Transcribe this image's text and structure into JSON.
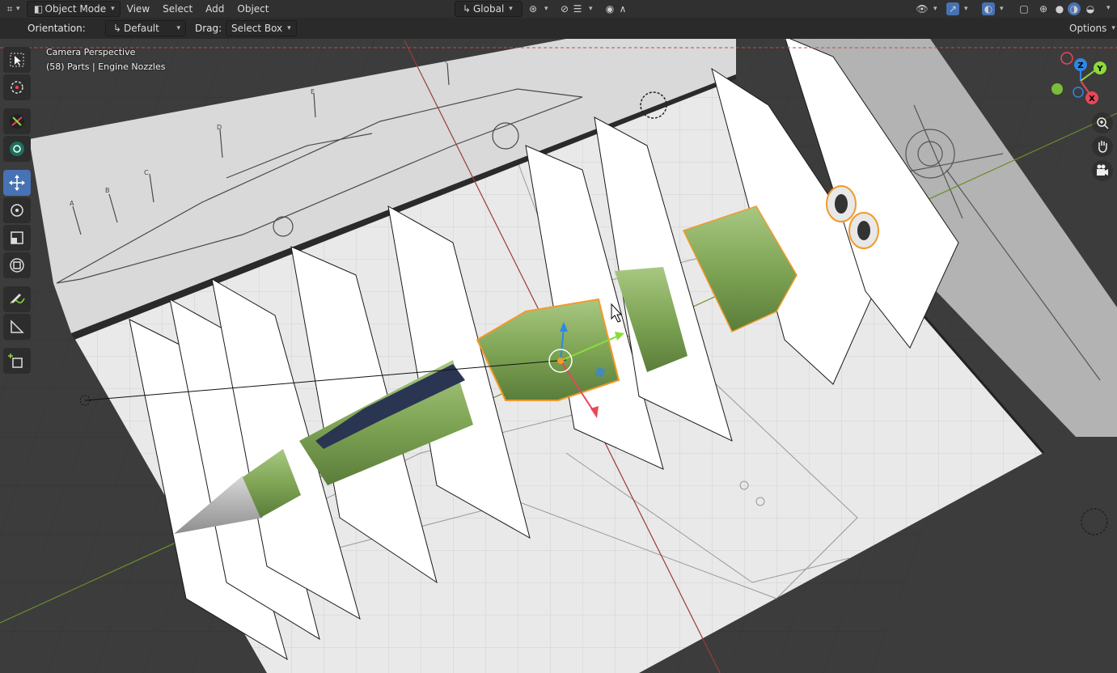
{
  "header": {
    "mode": "Object Mode",
    "menus": [
      "View",
      "Select",
      "Add",
      "Object"
    ],
    "transform_orientation": "Global"
  },
  "tool_settings": {
    "orientation_label": "Orientation:",
    "orientation_value": "Default",
    "drag_label": "Drag:",
    "drag_value": "Select Box",
    "options_label": "Options"
  },
  "viewport": {
    "view_name": "Camera Perspective",
    "selection_info": "(58) Parts | Engine Nozzles"
  },
  "gizmo": {
    "z": "Z",
    "y": "Y",
    "x": "X"
  },
  "colors": {
    "header_bg": "#303030",
    "active_tool": "#4772b3",
    "axis_x": "#e8475a",
    "axis_y": "#8bdc3a",
    "axis_z": "#2f86e8",
    "selection_outline": "#f29a2c",
    "fuselage_green": "#7fa555",
    "canopy_blue": "#2a3552"
  },
  "icons": [
    "editor-type-icon",
    "object-mode-icon",
    "orientation-icon",
    "pivot-icon",
    "snap-icon",
    "proportional-icon",
    "visibility-icon",
    "gizmo-icon",
    "overlay-icon",
    "xray-icon",
    "shading-wire-icon",
    "shading-solid-icon",
    "shading-material-icon",
    "shading-rendered-icon",
    "select-box-icon",
    "cursor-icon",
    "move-icon",
    "rotate-icon",
    "scale-icon",
    "transform-icon",
    "annotate-icon",
    "measure-icon",
    "add-cube-icon",
    "zoom-icon",
    "hand-icon",
    "camera-icon"
  ]
}
